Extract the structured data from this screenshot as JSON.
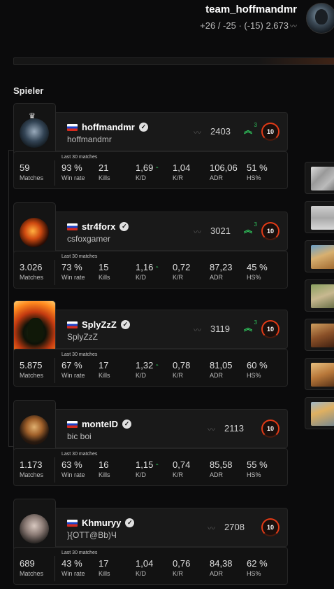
{
  "header": {
    "team_name": "team_hoffmandmr",
    "stats": "+26 / -25 · (-15) 2.673",
    "avatar_icon": "team-avatar"
  },
  "section": {
    "title": "Spieler"
  },
  "labels": {
    "last30": "Last 30 matches",
    "matches": "Matches",
    "winrate": "Win rate",
    "kills": "Kills",
    "kd": "K/D",
    "kr": "K/R",
    "adr": "ADR",
    "hs": "HS%"
  },
  "colors": {
    "level": "#e23a16",
    "streak": "#2fbf5a",
    "flag": [
      "#ffffff",
      "#1b43c8",
      "#d52b1e"
    ]
  },
  "players": [
    {
      "name": "hoffmandmr",
      "nickname": "hoffmandmr",
      "country": "RU",
      "elo": "2403",
      "streak": "3",
      "level": "10",
      "matches": "59",
      "winrate": "93 %",
      "kills": "21",
      "kd": "1,69",
      "kd_trend": "up",
      "kr": "1,04",
      "adr": "106,06",
      "hs": "51 %",
      "avatar_icon": "player-avatar-crown"
    },
    {
      "name": "str4forx",
      "nickname": "csfoxgamer",
      "country": "RU",
      "elo": "3021",
      "streak": "3",
      "level": "10",
      "matches": "3.026",
      "winrate": "73 %",
      "kills": "15",
      "kd": "1,16",
      "kd_trend": "up",
      "kr": "0,72",
      "adr": "87,23",
      "hs": "45 %",
      "avatar_icon": "player-avatar-fire"
    },
    {
      "name": "SplyZzZ",
      "nickname": "SplyZzZ",
      "country": "RU",
      "elo": "3119",
      "streak": "3",
      "level": "10",
      "matches": "5.875",
      "winrate": "67 %",
      "kills": "17",
      "kd": "1,32",
      "kd_trend": "up",
      "kr": "0,78",
      "adr": "81,05",
      "hs": "60 %",
      "avatar_icon": "player-avatar-burst"
    },
    {
      "name": "monteID",
      "nickname": "bic boi",
      "country": "RU",
      "elo": "2113",
      "streak": "",
      "level": "10",
      "matches": "1.173",
      "winrate": "63 %",
      "kills": "16",
      "kd": "1,15",
      "kd_trend": "up",
      "kr": "0,74",
      "adr": "85,58",
      "hs": "55 %",
      "avatar_icon": "player-avatar-mask"
    },
    {
      "name": "Khmuryy",
      "nickname": "}{OTT@Bb)Ч",
      "country": "RU",
      "elo": "2708",
      "streak": "",
      "level": "10",
      "matches": "689",
      "winrate": "43 %",
      "kills": "17",
      "kd": "1,04",
      "kd_trend": "",
      "kr": "0,76",
      "adr": "84,38",
      "hs": "62 %",
      "avatar_icon": "player-avatar-portrait"
    }
  ],
  "maps": [
    {
      "icon": "map-ancient"
    },
    {
      "icon": "map-vertigo"
    },
    {
      "icon": "map-dust2"
    },
    {
      "icon": "map-inferno"
    },
    {
      "icon": "map-mirage"
    },
    {
      "icon": "map-anubis"
    },
    {
      "icon": "map-nuke"
    }
  ]
}
